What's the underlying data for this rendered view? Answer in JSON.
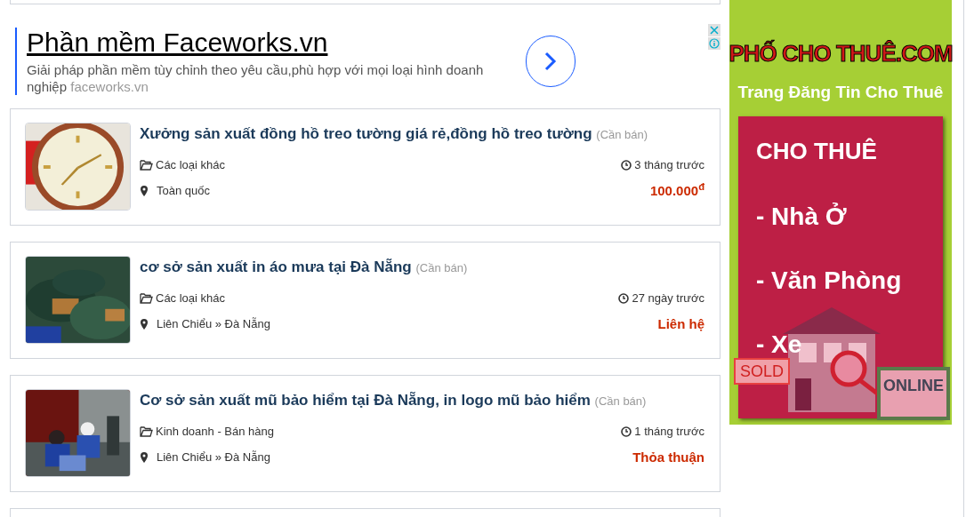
{
  "ad": {
    "title": "Phần mềm Faceworks.vn",
    "description": "Giải pháp phần mềm tùy chỉnh theo yêu cầu,phù hợp với mọi loại hình doanh nghiệp",
    "domain": "faceworks.vn"
  },
  "listings": [
    {
      "title": "Xưởng sản xuất đồng hồ treo tường giá rẻ,đồng hồ treo tường",
      "tag": "(Cần bán)",
      "category": "Các loại khác",
      "location": "Toàn quốc",
      "time": "3 tháng trước",
      "price": "100.000$^{đ}$"
    },
    {
      "title": "cơ sở sản xuất in áo mưa tại Đà Nẵng",
      "tag": "(Cần bán)",
      "category": "Các loại khác",
      "location": "Liên Chiểu » Đà Nẵng",
      "time": "27 ngày trước",
      "price": "Liên hệ"
    },
    {
      "title": "Cơ sở sản xuất mũ bảo hiểm tại Đà Nẵng, in logo mũ bảo hiểm",
      "tag": "(Cần bán)",
      "category": "Kinh doanh - Bán hàng",
      "location": "Liên Chiểu » Đà Nẵng",
      "time": "1 tháng trước",
      "price": "Thỏa thuận"
    }
  ],
  "banner": {
    "brand": "PHỐ CHO THUÊ.COM",
    "tagline": "Trang Đăng Tin Cho Thuê",
    "heading": "CHO THUÊ",
    "items": [
      "- Nhà Ở",
      "- Văn Phòng",
      "- Xe"
    ],
    "sign": "SOLD",
    "screen": "ONLINE"
  }
}
